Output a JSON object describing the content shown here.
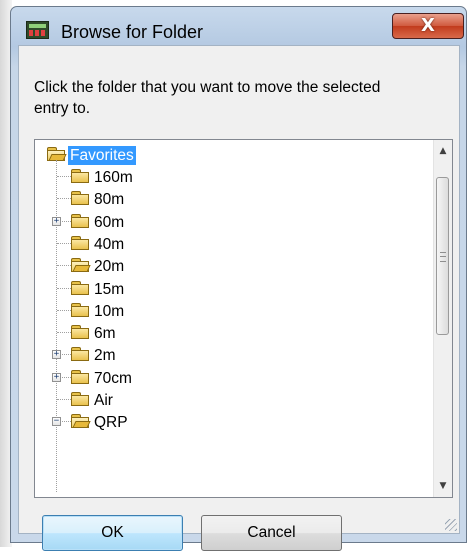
{
  "window": {
    "title": "Browse for Folder",
    "close_label": "X"
  },
  "prompt": "Click the folder that you want to move the selected entry to.",
  "tree": {
    "root": "Favorites",
    "items": [
      {
        "label": "160m",
        "expander": "",
        "open": false
      },
      {
        "label": "80m",
        "expander": "",
        "open": false
      },
      {
        "label": "60m",
        "expander": "+",
        "open": false
      },
      {
        "label": "40m",
        "expander": "",
        "open": false
      },
      {
        "label": "20m",
        "expander": "",
        "open": true
      },
      {
        "label": "15m",
        "expander": "",
        "open": false
      },
      {
        "label": "10m",
        "expander": "",
        "open": false
      },
      {
        "label": "6m",
        "expander": "",
        "open": false
      },
      {
        "label": "2m",
        "expander": "+",
        "open": false
      },
      {
        "label": "70cm",
        "expander": "+",
        "open": false
      },
      {
        "label": "Air",
        "expander": "",
        "open": false
      },
      {
        "label": "QRP",
        "expander": "−",
        "open": true
      }
    ]
  },
  "scrollbar": {
    "up_arrow": "▲",
    "down_arrow": "▼"
  },
  "buttons": {
    "ok": "OK",
    "cancel": "Cancel"
  }
}
